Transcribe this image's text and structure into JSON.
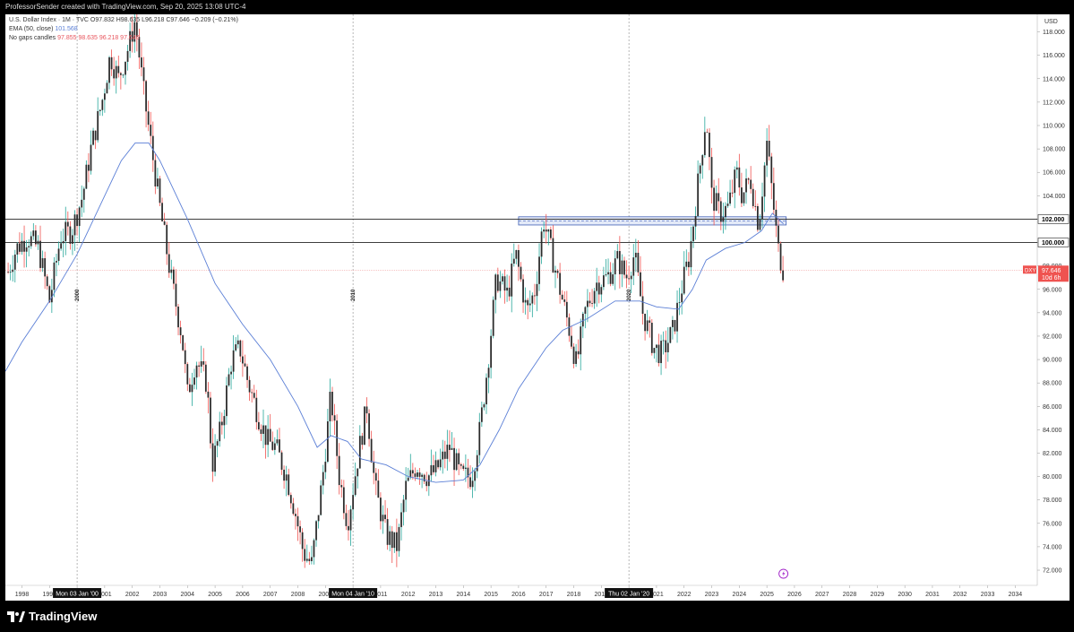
{
  "header": {
    "text": "ProfessorSender created with TradingView.com, Sep 20, 2025 13:08 UTC-4"
  },
  "legend": {
    "line1": "U.S. Dollar Index · 1M · TVC  O97.832  H98.635  L96.218  C97.646  −0.209 (−0.21%)",
    "line2_label": "EMA (50, close)",
    "line2_value": "101.568",
    "line3_label": "No gaps candles",
    "line3_values": "97.855  98.635  96.218  97.646"
  },
  "footer": {
    "brand": "TradingView"
  },
  "price_axis": {
    "currency": "USD",
    "price_badge": "DXY",
    "price_value": "97.646",
    "countdown": "10d 6h"
  },
  "crosshair_labels": [
    "Mon 03 Jan '00",
    "Mon 04 Jan '10",
    "Thu 02 Jan '20"
  ],
  "vertical_year_labels": [
    "2000",
    "2010",
    "2020"
  ],
  "colors": {
    "up": "#26a69a",
    "down": "#ef5350",
    "candle_body": "#2b2b2b",
    "ema": "#5b7fd6",
    "level": "#222222",
    "zone_fill": "#d8e1f5",
    "zone_stroke": "#3f5fb5",
    "last_price": "#f0a0a0"
  },
  "icons": [
    "tradingview-logo-icon",
    "lightning-icon"
  ],
  "chart_data": {
    "type": "candlestick",
    "title": "U.S. Dollar Index · 1M · TVC",
    "ylim": [
      70.7,
      119.5
    ],
    "xlim": [
      1997.4,
      2034.8
    ],
    "y_ticks": [
      72,
      74,
      76,
      78,
      80,
      82,
      84,
      86,
      88,
      90,
      92,
      94,
      96,
      98,
      100,
      102,
      104,
      106,
      108,
      110,
      112,
      114,
      116,
      118
    ],
    "x_ticks": [
      "1998",
      "1999",
      "2000",
      "2001",
      "2002",
      "2003",
      "2004",
      "2005",
      "2006",
      "2007",
      "2008",
      "2009",
      "2010",
      "2011",
      "2012",
      "2013",
      "2014",
      "2015",
      "2016",
      "2017",
      "2018",
      "2019",
      "2020",
      "2021",
      "2022",
      "2023",
      "2024",
      "2025",
      "2026",
      "2027",
      "2028",
      "2029",
      "2030",
      "2031",
      "2032",
      "2033",
      "2034"
    ],
    "horizontal_levels": [
      {
        "value": 102.0,
        "label": "102.000"
      },
      {
        "value": 100.0,
        "label": "100.000"
      }
    ],
    "resistance_zone": {
      "x_start": 2016.0,
      "x_end": 2025.7,
      "y_low": 101.5,
      "y_high": 102.2
    },
    "last_price": 97.646,
    "close_path": [
      [
        1997.5,
        97.5
      ],
      [
        1997.8,
        99.5
      ],
      [
        1998.2,
        100.5
      ],
      [
        1998.6,
        99.5
      ],
      [
        1999.0,
        95.0
      ],
      [
        1999.4,
        100.5
      ],
      [
        1999.8,
        101.0
      ],
      [
        2000.2,
        104.0
      ],
      [
        2000.5,
        108.0
      ],
      [
        2000.9,
        112.0
      ],
      [
        2001.2,
        116.0
      ],
      [
        2001.5,
        114.0
      ],
      [
        2001.9,
        117.0
      ],
      [
        2002.1,
        119.0
      ],
      [
        2002.4,
        113.0
      ],
      [
        2002.7,
        108.0
      ],
      [
        2003.0,
        103.0
      ],
      [
        2003.4,
        97.0
      ],
      [
        2003.8,
        92.0
      ],
      [
        2004.0,
        87.0
      ],
      [
        2004.3,
        90.0
      ],
      [
        2004.7,
        88.0
      ],
      [
        2004.9,
        81.0
      ],
      [
        2005.2,
        84.0
      ],
      [
        2005.6,
        90.0
      ],
      [
        2005.9,
        91.0
      ],
      [
        2006.2,
        88.0
      ],
      [
        2006.6,
        85.0
      ],
      [
        2006.9,
        83.0
      ],
      [
        2007.2,
        82.5
      ],
      [
        2007.6,
        80.0
      ],
      [
        2007.9,
        77.0
      ],
      [
        2008.2,
        73.5
      ],
      [
        2008.5,
        72.5
      ],
      [
        2008.9,
        80.0
      ],
      [
        2009.2,
        87.0
      ],
      [
        2009.5,
        80.0
      ],
      [
        2009.8,
        76.0
      ],
      [
        2010.2,
        82.0
      ],
      [
        2010.5,
        86.0
      ],
      [
        2010.8,
        79.0
      ],
      [
        2011.2,
        75.0
      ],
      [
        2011.6,
        74.0
      ],
      [
        2011.9,
        79.0
      ],
      [
        2012.3,
        81.0
      ],
      [
        2012.7,
        80.0
      ],
      [
        2013.0,
        80.5
      ],
      [
        2013.5,
        82.5
      ],
      [
        2013.9,
        80.0
      ],
      [
        2014.3,
        80.0
      ],
      [
        2014.6,
        84.0
      ],
      [
        2014.9,
        90.0
      ],
      [
        2015.2,
        97.0
      ],
      [
        2015.6,
        95.5
      ],
      [
        2015.9,
        99.0
      ],
      [
        2016.3,
        94.0
      ],
      [
        2016.6,
        96.0
      ],
      [
        2016.9,
        102.0
      ],
      [
        2017.1,
        100.0
      ],
      [
        2017.5,
        96.0
      ],
      [
        2017.8,
        93.0
      ],
      [
        2018.1,
        89.5
      ],
      [
        2018.4,
        94.0
      ],
      [
        2018.8,
        96.5
      ],
      [
        2019.2,
        97.0
      ],
      [
        2019.6,
        98.5
      ],
      [
        2019.9,
        97.0
      ],
      [
        2020.2,
        99.0
      ],
      [
        2020.5,
        94.0
      ],
      [
        2020.9,
        91.0
      ],
      [
        2021.2,
        90.5
      ],
      [
        2021.6,
        92.5
      ],
      [
        2021.9,
        96.0
      ],
      [
        2022.2,
        99.0
      ],
      [
        2022.5,
        105.0
      ],
      [
        2022.8,
        111.0
      ],
      [
        2023.0,
        104.0
      ],
      [
        2023.3,
        102.5
      ],
      [
        2023.6,
        103.0
      ],
      [
        2023.9,
        106.0
      ],
      [
        2024.1,
        104.0
      ],
      [
        2024.4,
        105.5
      ],
      [
        2024.7,
        101.5
      ],
      [
        2025.0,
        108.5
      ],
      [
        2025.2,
        104.0
      ],
      [
        2025.4,
        99.5
      ],
      [
        2025.6,
        97.6
      ]
    ],
    "ema_path": [
      [
        1997.4,
        89.0
      ],
      [
        1998.0,
        91.5
      ],
      [
        1999.0,
        95.0
      ],
      [
        2000.0,
        99.0
      ],
      [
        2001.0,
        104.0
      ],
      [
        2001.6,
        107.0
      ],
      [
        2002.1,
        108.5
      ],
      [
        2002.6,
        108.5
      ],
      [
        2003.0,
        107.0
      ],
      [
        2004.0,
        102.0
      ],
      [
        2005.0,
        96.5
      ],
      [
        2006.0,
        93.0
      ],
      [
        2007.0,
        90.0
      ],
      [
        2008.0,
        86.0
      ],
      [
        2008.7,
        82.5
      ],
      [
        2009.2,
        83.5
      ],
      [
        2009.8,
        83.0
      ],
      [
        2010.3,
        81.5
      ],
      [
        2011.2,
        81.0
      ],
      [
        2012.0,
        80.0
      ],
      [
        2013.0,
        79.5
      ],
      [
        2014.0,
        79.7
      ],
      [
        2014.6,
        81.0
      ],
      [
        2015.3,
        84.0
      ],
      [
        2016.0,
        87.5
      ],
      [
        2017.0,
        91.0
      ],
      [
        2017.6,
        92.5
      ],
      [
        2018.5,
        93.5
      ],
      [
        2019.5,
        95.0
      ],
      [
        2020.4,
        95.0
      ],
      [
        2021.0,
        94.5
      ],
      [
        2021.8,
        94.3
      ],
      [
        2022.3,
        96.0
      ],
      [
        2022.8,
        98.5
      ],
      [
        2023.5,
        99.5
      ],
      [
        2024.2,
        100.0
      ],
      [
        2024.8,
        101.0
      ],
      [
        2025.2,
        102.5
      ],
      [
        2025.6,
        101.6
      ]
    ]
  }
}
